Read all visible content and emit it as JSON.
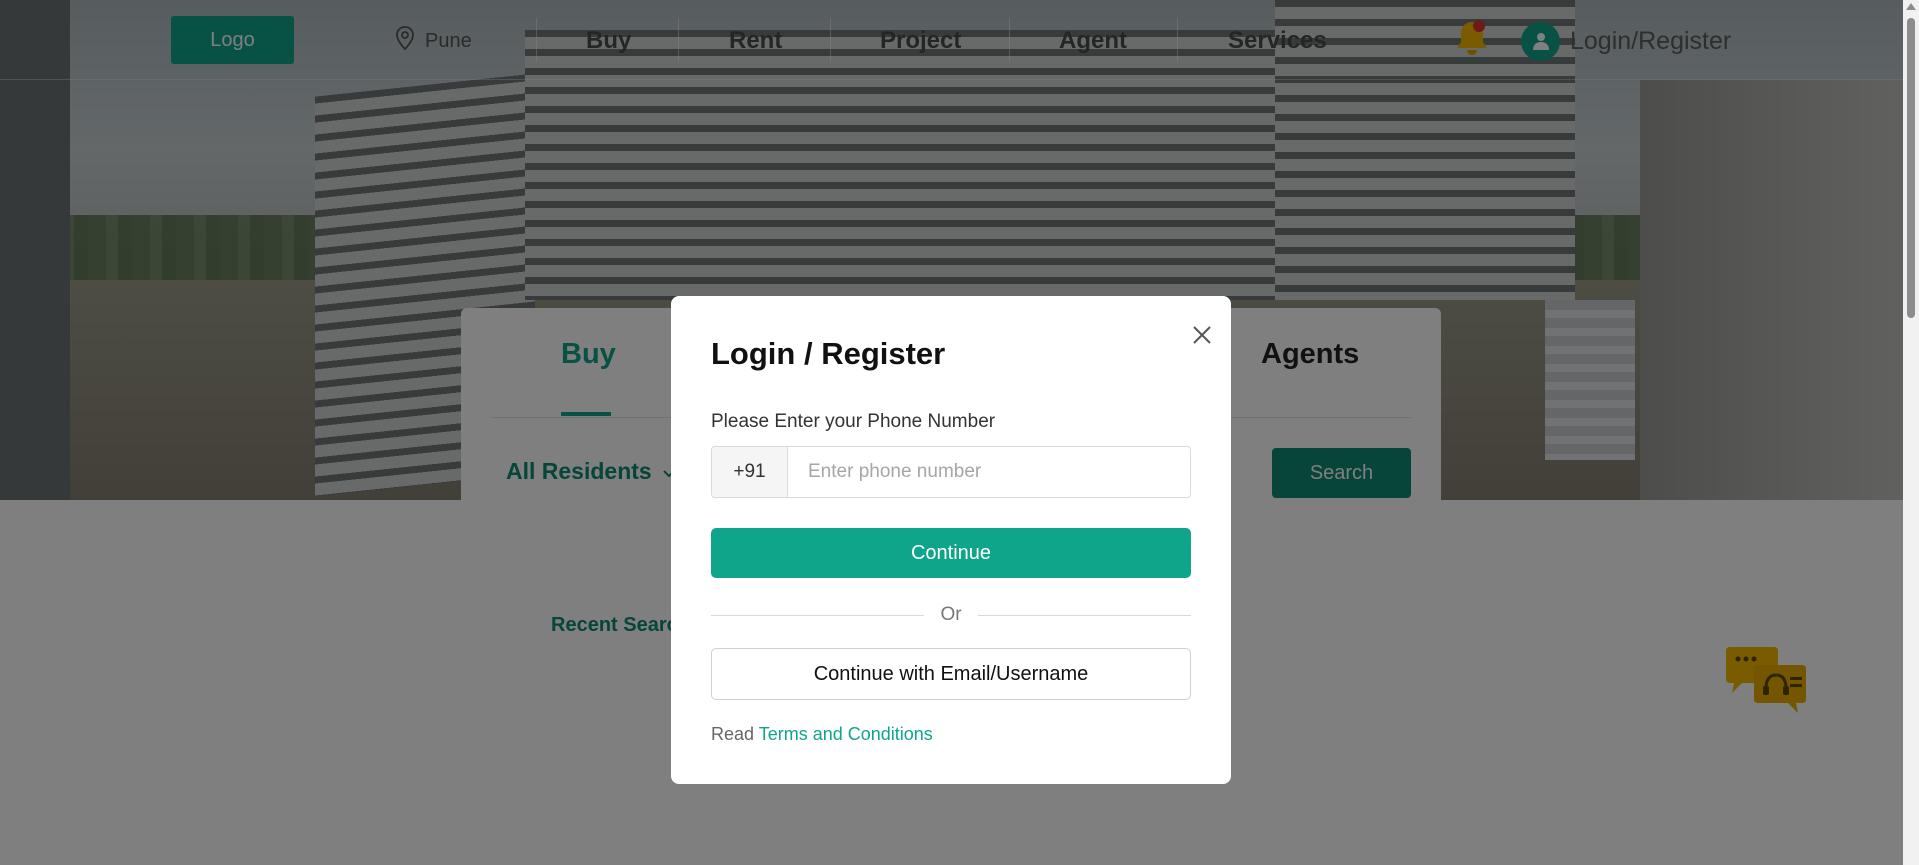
{
  "navbar": {
    "logo_label": "Logo",
    "location": "Pune",
    "items": [
      {
        "label": "Buy"
      },
      {
        "label": "Rent"
      },
      {
        "label": "Project"
      },
      {
        "label": "Agent"
      },
      {
        "label": "Services"
      }
    ],
    "login_label": "Login/Register",
    "icons": {
      "location": "map-pin-icon",
      "notification": "bell-icon",
      "user": "user-icon"
    }
  },
  "search_card": {
    "tabs": [
      {
        "label": "Buy",
        "active": true
      },
      {
        "label": "Agents",
        "active": false
      }
    ],
    "filter_label": "All Residents",
    "search_button": "Search"
  },
  "recent_searches_label": "Recent Searc",
  "modal": {
    "title": "Login / Register",
    "phone_label": "Please Enter your Phone Number",
    "country_code": "+91",
    "phone_placeholder": "Enter phone number",
    "phone_value": "",
    "continue_label": "Continue",
    "or_label": "Or",
    "email_button_label": "Continue with Email/Username",
    "terms_prefix": "Read",
    "terms_link": "Terms and Conditions"
  },
  "colors": {
    "accent": "#0ea58a",
    "accent_dark": "#0f8a75",
    "notification_dot": "#e0322d",
    "bell": "#f2b600",
    "chat_icon": "#f2b600"
  }
}
